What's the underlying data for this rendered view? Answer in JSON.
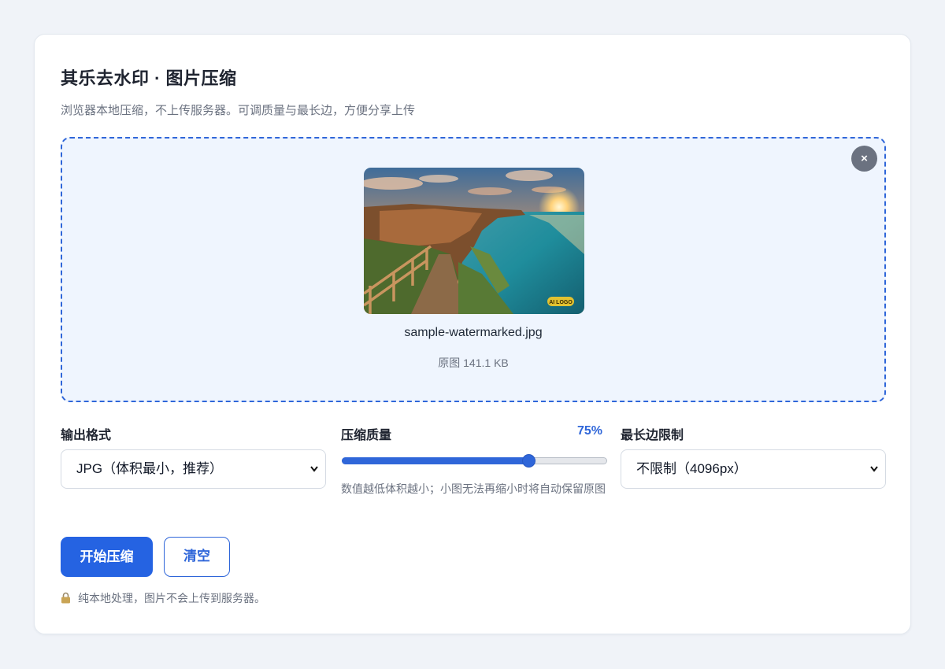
{
  "header": {
    "title": "其乐去水印 · 图片压缩",
    "subtitle": "浏览器本地压缩，不上传服务器。可调质量与最长边，方便分享上传"
  },
  "dropzone": {
    "close_icon": "close-icon",
    "close_label": "×",
    "file_name": "sample-watermarked.jpg",
    "file_size": "原图 141.1 KB",
    "thumbnail_watermark": "AI LOGO",
    "accent_color": "#2f66d9"
  },
  "settings": {
    "format": {
      "label": "输出格式",
      "selected": "JPG（体积最小，推荐）"
    },
    "quality": {
      "label": "压缩质量",
      "value_text": "75%",
      "value": 75,
      "hint": "数值越低体积越小；小图无法再缩小时将自动保留原图"
    },
    "max_edge": {
      "label": "最长边限制",
      "selected": "不限制（4096px）"
    }
  },
  "actions": {
    "start_label": "开始压缩",
    "clear_label": "清空"
  },
  "footer": {
    "lock_icon": "lock-icon",
    "note": "纯本地处理，图片不会上传到服务器。"
  }
}
